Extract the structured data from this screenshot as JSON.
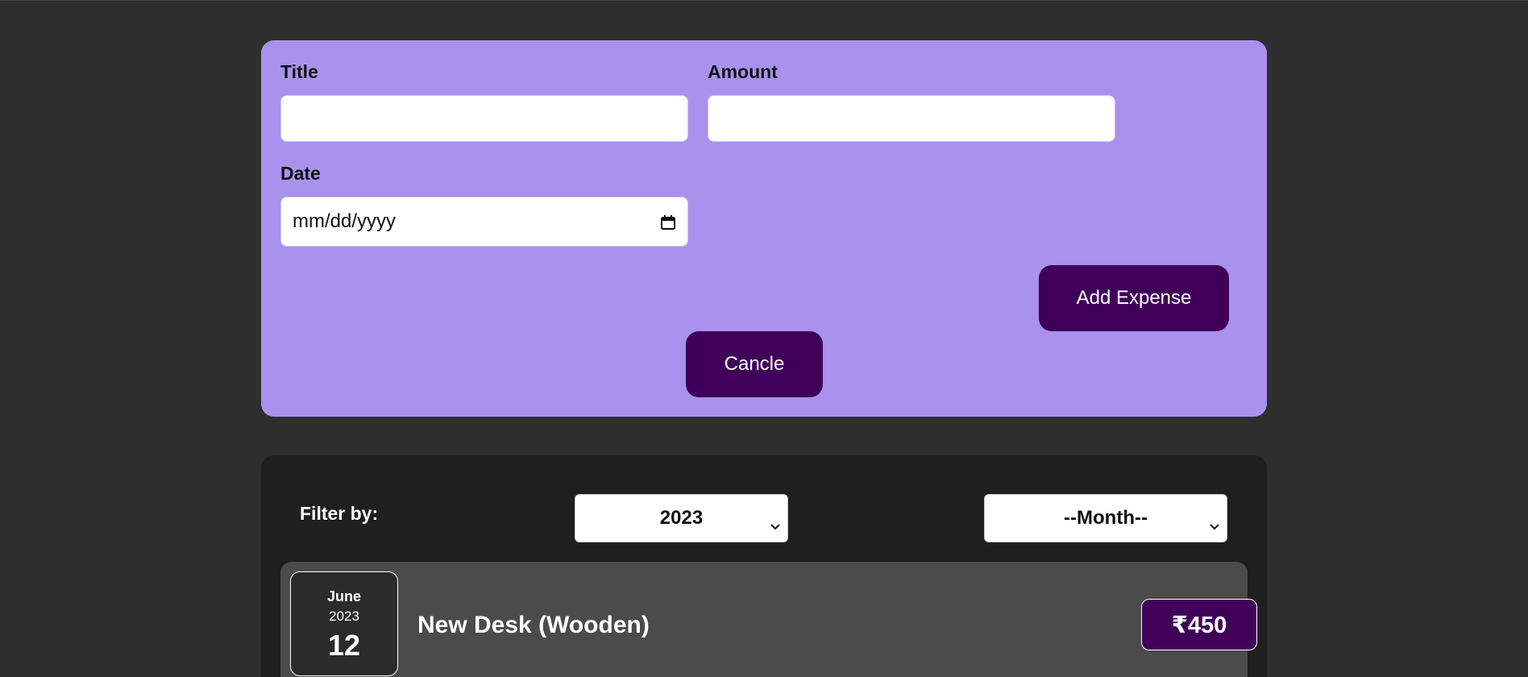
{
  "form": {
    "title_label": "Title",
    "title_value": "",
    "amount_label": "Amount",
    "amount_value": "",
    "date_label": "Date",
    "date_placeholder": "mm/dd/yyyy",
    "add_button": "Add Expense",
    "cancel_button": "Cancle"
  },
  "filter": {
    "label": "Filter by:",
    "year_selected": "2023",
    "month_selected": "--Month--"
  },
  "expenses": [
    {
      "month": "June",
      "year": "2023",
      "day": "12",
      "title": "New Desk (Wooden)",
      "amount": "₹450"
    }
  ],
  "colors": {
    "page_background": "#2e2e2e",
    "form_background": "#a892ee",
    "button_background": "#40005a",
    "panel_background": "#1f1f1f",
    "item_background": "#4b4b4b"
  },
  "icons": {
    "date_picker": "calendar-icon",
    "select_arrow": "chevron-down-icon"
  }
}
